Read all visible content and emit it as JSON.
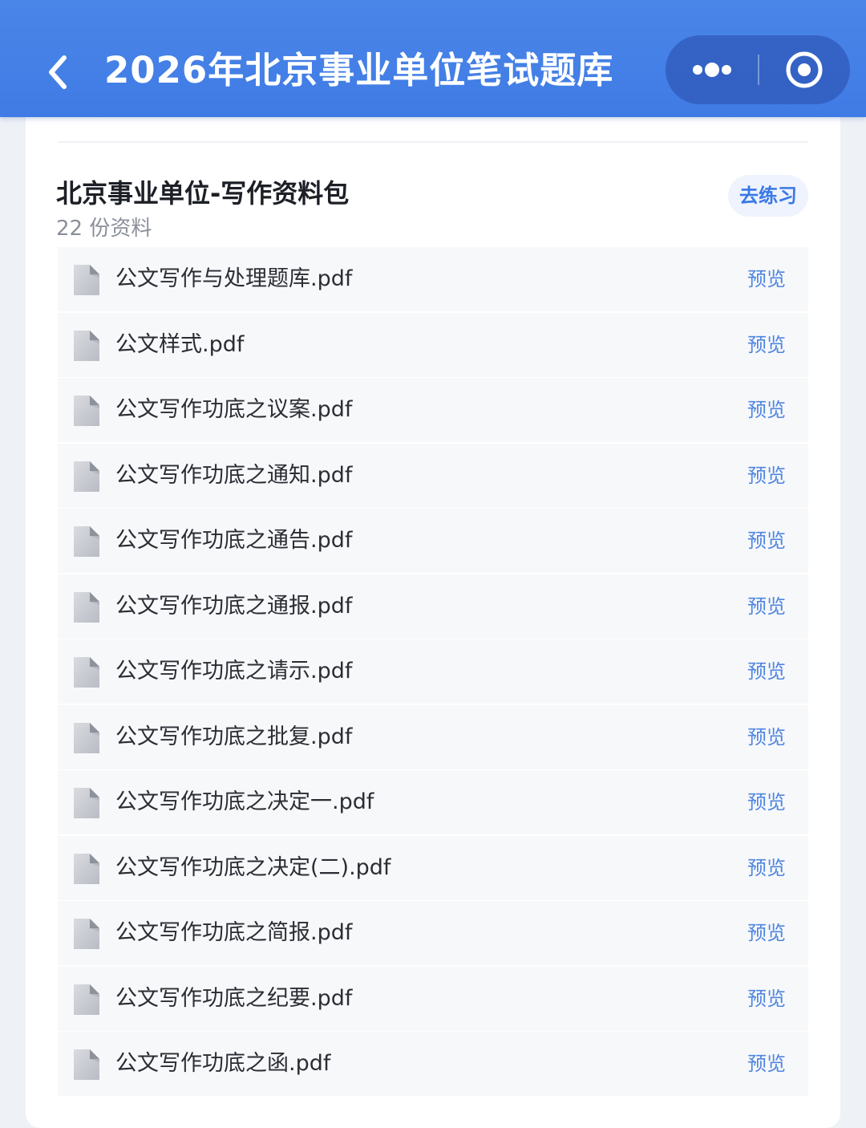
{
  "navbar": {
    "title": "2026年北京事业单位笔试题库",
    "back_icon": "chevron-left-icon",
    "more_icon": "more-dots-icon",
    "close_icon": "target-close-icon"
  },
  "section": {
    "title": "北京事业单位-写作资料包",
    "count": "22 份资料",
    "practice_label": "去练习"
  },
  "files": [
    {
      "name": "公文写作与处理题库.pdf",
      "action": "预览"
    },
    {
      "name": "公文样式.pdf",
      "action": "预览"
    },
    {
      "name": "公文写作功底之议案.pdf",
      "action": "预览"
    },
    {
      "name": "公文写作功底之通知.pdf",
      "action": "预览"
    },
    {
      "name": "公文写作功底之通告.pdf",
      "action": "预览"
    },
    {
      "name": "公文写作功底之通报.pdf",
      "action": "预览"
    },
    {
      "name": "公文写作功底之请示.pdf",
      "action": "预览"
    },
    {
      "name": "公文写作功底之批复.pdf",
      "action": "预览"
    },
    {
      "name": "公文写作功底之决定一.pdf",
      "action": "预览"
    },
    {
      "name": "公文写作功底之决定(二).pdf",
      "action": "预览"
    },
    {
      "name": "公文写作功底之简报.pdf",
      "action": "预览"
    },
    {
      "name": "公文写作功底之纪要.pdf",
      "action": "预览"
    },
    {
      "name": "公文写作功底之函.pdf",
      "action": "预览"
    }
  ],
  "colors": {
    "navbar": "#4a86e8",
    "accent": "#4f86e0",
    "row_bg": "#f7f8fa"
  }
}
